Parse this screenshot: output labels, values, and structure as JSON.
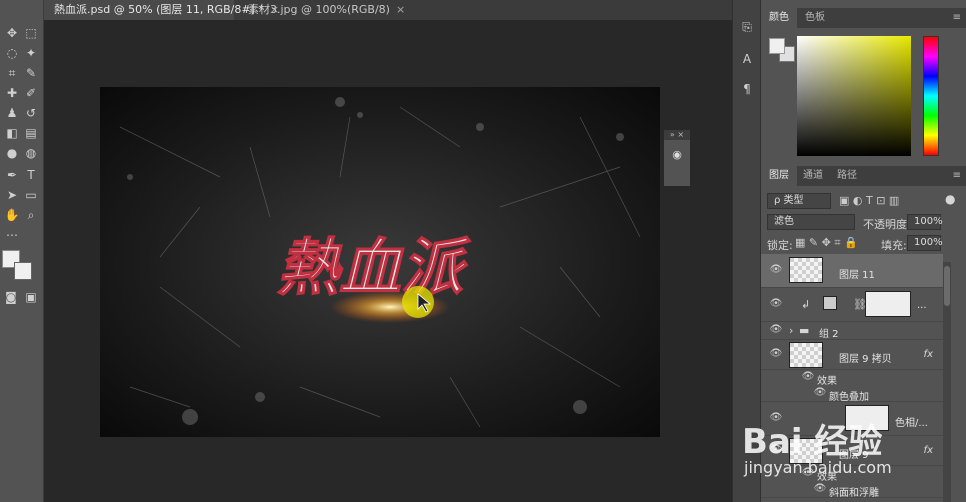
{
  "tabs": [
    {
      "label": "熱血派.psd @ 50% (图层 11, RGB/8#) *",
      "close": "×"
    },
    {
      "label": "素材3.jpg @ 100%(RGB/8)",
      "close": "×"
    }
  ],
  "canvas": {
    "title_text": "熱血派"
  },
  "float_panel": {
    "collapse": "»",
    "close": "×"
  },
  "color_panel": {
    "tabs": [
      "颜色",
      "色板"
    ]
  },
  "layers_panel": {
    "tabs": [
      "图层",
      "通道",
      "路径"
    ],
    "filter_label": "ρ 类型",
    "blend_mode": "滤色",
    "opacity_label": "不透明度:",
    "opacity_value": "100%",
    "lock_label": "锁定:",
    "fill_label": "填充:",
    "fill_value": "100%",
    "layers": [
      {
        "name": "图层 11",
        "selected": true
      },
      {
        "name": "...",
        "type": "adjustment"
      },
      {
        "name": "组 2",
        "type": "group"
      },
      {
        "name": "图层 9 拷贝",
        "fx": "fx"
      },
      {
        "name": "效果",
        "type": "effect-header"
      },
      {
        "name": "颜色叠加",
        "type": "effect"
      },
      {
        "name": "色相/...",
        "type": "adjustment"
      },
      {
        "name": "图层 9",
        "fx": "fx"
      },
      {
        "name": "效果",
        "type": "effect-header"
      },
      {
        "name": "斜面和浮雕",
        "type": "effect"
      }
    ]
  },
  "watermark": {
    "logo": "Bai 经验",
    "url": "jingyan.baidu.com"
  },
  "colors": {
    "accent_yellow": "#e6e600",
    "canvas_bg": "#141414"
  }
}
